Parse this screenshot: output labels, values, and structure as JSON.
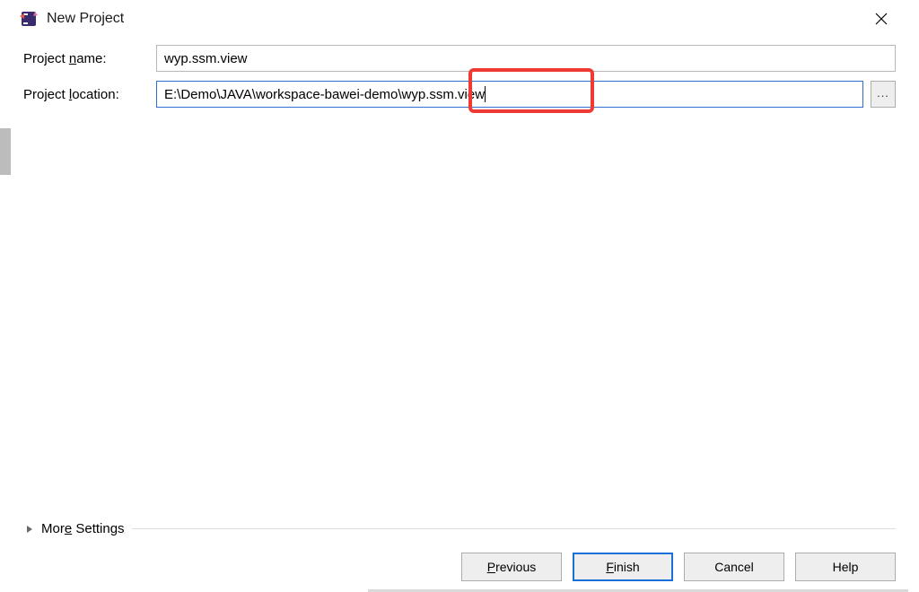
{
  "titlebar": {
    "title": "New Project"
  },
  "fields": {
    "name_label_pre": "Project ",
    "name_label_mn": "n",
    "name_label_post": "ame:",
    "name_value": "wyp.ssm.view",
    "location_label_pre": "Project ",
    "location_label_mn": "l",
    "location_label_post": "ocation:",
    "location_value_pre": "E:\\Demo\\JAVA\\workspace-bawei-demo\\",
    "location_value_highlight": "wyp.ssm.view",
    "browse_label": "..."
  },
  "more_settings": {
    "label_pre": "Mor",
    "label_mn": "e",
    "label_post": " Settings"
  },
  "buttons": {
    "previous_mn": "P",
    "previous_post": "revious",
    "finish_mn": "F",
    "finish_post": "inish",
    "cancel": "Cancel",
    "help": "Help"
  }
}
